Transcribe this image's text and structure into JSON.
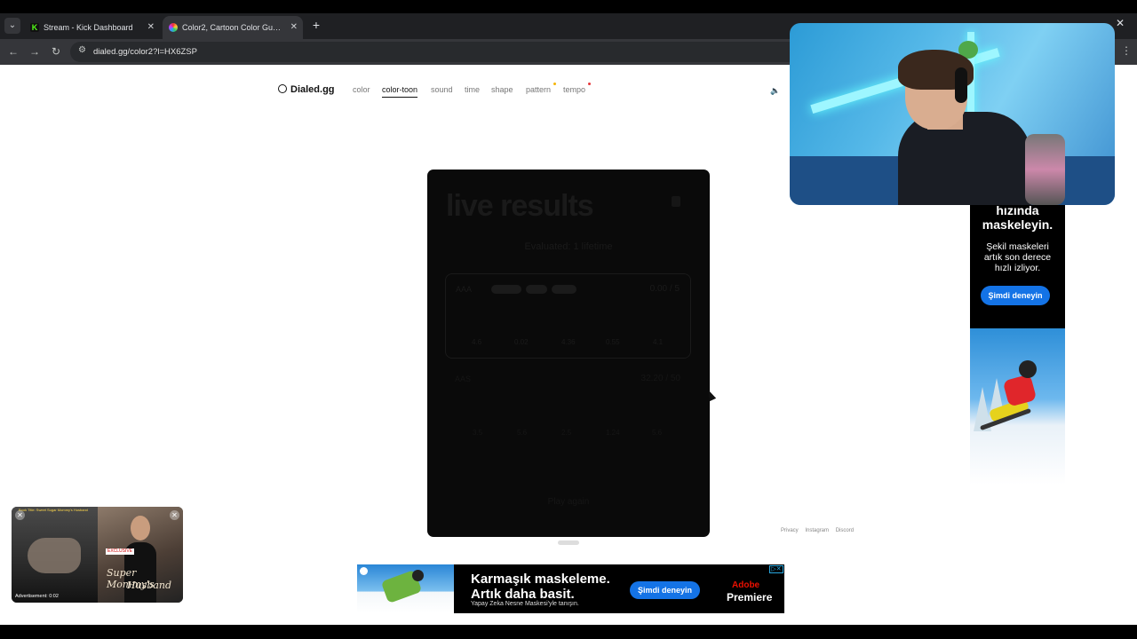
{
  "browser": {
    "tabs": [
      {
        "title": "Stream - Kick Dashboard",
        "favicon": "kick-icon",
        "active": false
      },
      {
        "title": "Color2, Cartoon Color Guessing",
        "favicon": "color-wheel-icon",
        "active": true
      }
    ],
    "url": "dialed.gg/color2?l=HX6ZSP"
  },
  "site": {
    "logo": "Dialed.gg",
    "nav": [
      "color",
      "color-toon",
      "sound",
      "time",
      "shape",
      "pattern",
      "tempo"
    ],
    "active_nav": "color-toon",
    "nav_dot_colors": {
      "pattern": "#f5b400",
      "tempo": "#e5363a"
    },
    "footer_links": [
      "Privacy",
      "Instagram",
      "Discord"
    ]
  },
  "modal": {
    "title": "live results",
    "subtitle": "Evaluated: 1 lifetime",
    "player1": {
      "name": "AAA",
      "score": "0.00 / 5",
      "values": [
        "4.6",
        "0.02",
        "4.36",
        "0.55",
        "4.1"
      ]
    },
    "player2": {
      "name": "AAS",
      "score": "32.20 / 50",
      "values": [
        "3.5",
        "5.6",
        "2.5",
        "1.24",
        "5.6"
      ]
    },
    "play_again": "Play again"
  },
  "side_ad": {
    "headline": [
      "hızında",
      "maskeleyin."
    ],
    "body": [
      "Şekil maskeleri",
      "artık son derece",
      "hızlı izliyor."
    ],
    "cta": "Şimdi deneyin"
  },
  "banner_ad": {
    "headline": [
      "Karmaşık maskeleme.",
      "Artık daha basit."
    ],
    "tagline": "Yapay Zeka Nesne Maskesi'yle tanışın.",
    "cta": "Şimdi deneyin",
    "brand": [
      "Adobe",
      "Premiere"
    ]
  },
  "video_ad": {
    "top_text": "Book Title: Sweet Sugar Mommy's Husband",
    "tag": "EXCLUSIVE",
    "title": [
      "Super Mommy's",
      "Husband"
    ],
    "label": "Advertisement: 0:02"
  }
}
